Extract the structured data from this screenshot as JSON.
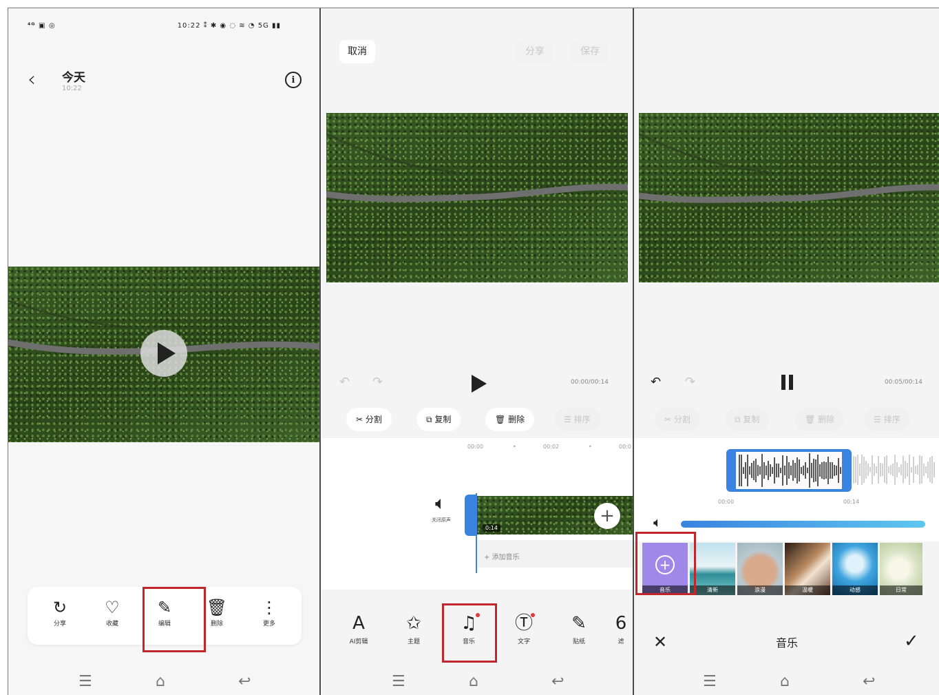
{
  "panel1": {
    "status_left": "⁴ᴳ ▣ ◎",
    "status_right": "10:22 ⁑ ✱ ◉ ◌ ≋ ◔ 5G ▮▮",
    "back_icon": "‹",
    "title": "今天",
    "subtitle": "10:22",
    "info_icon": "i",
    "toolbar": [
      {
        "icon": "share-icon",
        "glyph": "↻",
        "label": "分享"
      },
      {
        "icon": "heart-icon",
        "glyph": "♡",
        "label": "收藏"
      },
      {
        "icon": "edit-icon",
        "glyph": "✎",
        "label": "编辑"
      },
      {
        "icon": "trash-icon",
        "glyph": "🗑",
        "label": "删除"
      },
      {
        "icon": "more-icon",
        "glyph": "⋮",
        "label": "更多"
      }
    ],
    "nav": [
      "☰",
      "⌂",
      "↩"
    ]
  },
  "panel2": {
    "cancel_label": "取消",
    "share_label": "分享",
    "save_label": "保存",
    "undo": "↶",
    "redo": "↷",
    "timecode": "00:00/00:14",
    "edit_pills": [
      {
        "icon": "scissors-icon",
        "glyph": "✂",
        "label": "分割"
      },
      {
        "icon": "copy-icon",
        "glyph": "⧉",
        "label": "复制"
      },
      {
        "icon": "trash-icon",
        "glyph": "🗑",
        "label": "删除"
      },
      {
        "icon": "sort-icon",
        "glyph": "☰",
        "label": "排序"
      }
    ],
    "ruler_marks": [
      "00:00",
      "•",
      "00:02",
      "•",
      "00:0"
    ],
    "volume_label": "关闭原声",
    "clip_duration": "0:14",
    "add_music_label": "+ 添加音乐",
    "tools": [
      {
        "icon": "ai-edit-icon",
        "glyph": "A",
        "label": "AI剪辑",
        "dot": false
      },
      {
        "icon": "theme-icon",
        "glyph": "✩",
        "label": "主题",
        "dot": false
      },
      {
        "icon": "music-icon",
        "glyph": "♫",
        "label": "音乐",
        "dot": true
      },
      {
        "icon": "text-icon",
        "glyph": "Ⓣ",
        "label": "文字",
        "dot": true
      },
      {
        "icon": "sticker-icon",
        "glyph": "✎",
        "label": "贴纸",
        "dot": false
      },
      {
        "icon": "filter-icon",
        "glyph": "6",
        "label": "滤",
        "dot": false
      }
    ],
    "nav": [
      "☰",
      "⌂",
      "↩"
    ]
  },
  "panel3": {
    "undo": "↶",
    "redo": "↷",
    "timecode": "00:05/00:14",
    "edit_pills": [
      {
        "icon": "scissors-icon",
        "glyph": "✂",
        "label": "分割"
      },
      {
        "icon": "copy-icon",
        "glyph": "⧉",
        "label": "复制"
      },
      {
        "icon": "trash-icon",
        "glyph": "🗑",
        "label": "删除"
      },
      {
        "icon": "sort-icon",
        "glyph": "☰",
        "label": "排序"
      }
    ],
    "wave_start": "00:00",
    "wave_end": "00:14",
    "volume_level": 1.0,
    "music_items": [
      {
        "label": "音乐",
        "kind": "add"
      },
      {
        "label": "清新",
        "kind": "sea"
      },
      {
        "label": "浪漫",
        "kind": "hands"
      },
      {
        "label": "温暖",
        "kind": "warm"
      },
      {
        "label": "动感",
        "kind": "blue"
      },
      {
        "label": "日常",
        "kind": "light"
      }
    ],
    "close_icon": "✕",
    "title": "音乐",
    "confirm_icon": "✓",
    "nav": [
      "☰",
      "⌂",
      "↩"
    ]
  },
  "colors": {
    "accent_blue": "#3a83e0",
    "highlight_red": "#c0262b",
    "music_purple": "#9f88e8",
    "notification_dot": "#e5363d"
  }
}
